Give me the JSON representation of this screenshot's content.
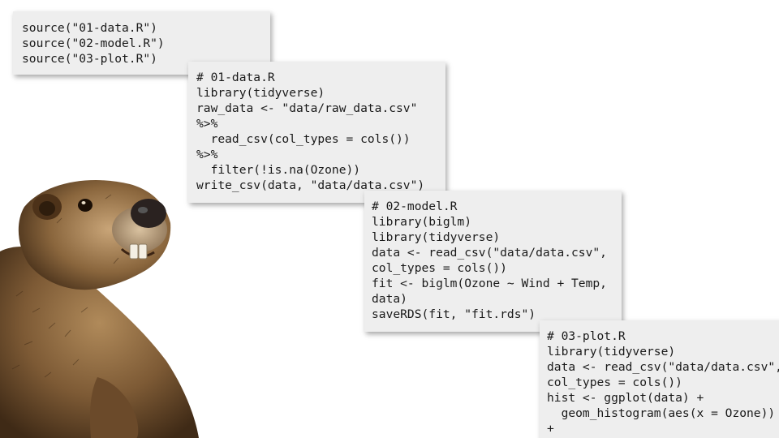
{
  "cards": {
    "main": {
      "lines": [
        "source(\"01-data.R\")",
        "source(\"02-model.R\")",
        "source(\"03-plot.R\")"
      ]
    },
    "data": {
      "lines": [
        "# 01-data.R",
        "library(tidyverse)",
        "raw_data <- \"data/raw_data.csv\"",
        "%>%",
        "  read_csv(col_types = cols())",
        "%>%",
        "  filter(!is.na(Ozone))",
        "write_csv(data, \"data/data.csv\")"
      ]
    },
    "model": {
      "lines": [
        "# 02-model.R",
        "library(biglm)",
        "library(tidyverse)",
        "data <- read_csv(\"data/data.csv\",",
        "col_types = cols())",
        "fit <- biglm(Ozone ~ Wind + Temp,",
        "data)",
        "saveRDS(fit, \"fit.rds\")"
      ]
    },
    "plot": {
      "lines": [
        "# 03-plot.R",
        "library(tidyverse)",
        "data <- read_csv(\"data/data.csv\",",
        "col_types = cols())",
        "hist <- ggplot(data) +",
        "  geom_histogram(aes(x = Ozone))",
        "+"
      ]
    }
  },
  "colors": {
    "card_background": "#eeeeee",
    "code_text": "#1a1a1a",
    "fur_dark": "#5a3d22",
    "fur_light": "#a9855a"
  },
  "image": {
    "subject": "groundhog-photo"
  }
}
